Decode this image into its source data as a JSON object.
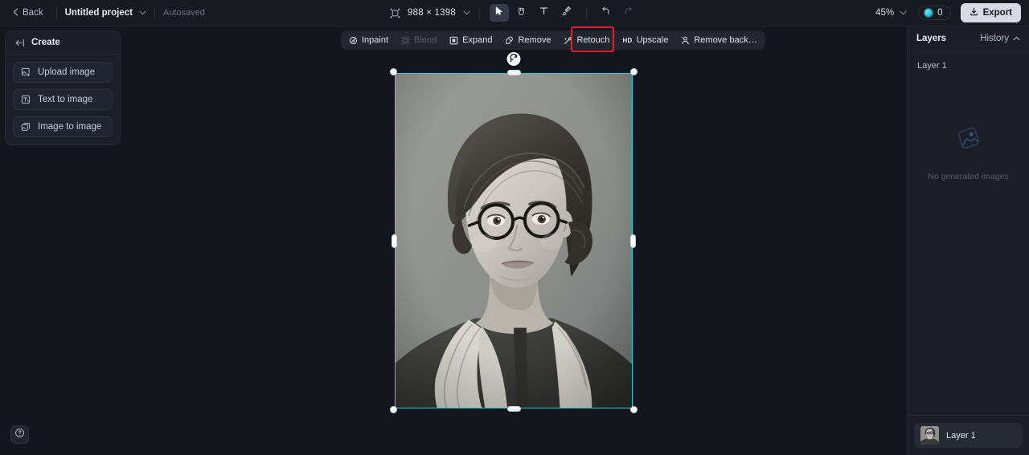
{
  "topbar": {
    "back_label": "Back",
    "project_name": "Untitled project",
    "autosaved_label": "Autosaved",
    "canvas_size": "988 × 1398",
    "zoom_level": "45%",
    "credits_count": "0",
    "export_label": "Export",
    "tools": [
      {
        "name": "select-tool",
        "icon": "cursor-icon",
        "active": true,
        "disabled": false
      },
      {
        "name": "hand-tool",
        "icon": "hand-icon",
        "active": false,
        "disabled": false
      },
      {
        "name": "text-tool",
        "icon": "text-icon",
        "active": false,
        "disabled": false
      },
      {
        "name": "brush-tool",
        "icon": "brush-icon",
        "active": false,
        "disabled": false
      },
      {
        "name": "undo-button",
        "icon": "undo-icon",
        "active": false,
        "disabled": false
      },
      {
        "name": "redo-button",
        "icon": "redo-icon",
        "active": false,
        "disabled": true
      }
    ]
  },
  "sidebar": {
    "title": "Create",
    "items": [
      {
        "label": "Upload image",
        "icon": "upload-image-icon"
      },
      {
        "label": "Text to image",
        "icon": "text-to-image-icon"
      },
      {
        "label": "Image to image",
        "icon": "image-to-image-icon"
      }
    ]
  },
  "floating_toolbar": {
    "items": [
      {
        "label": "Inpaint",
        "icon": "inpaint-icon",
        "disabled": false,
        "highlighted": false
      },
      {
        "label": "Blend",
        "icon": "blend-icon",
        "disabled": true,
        "highlighted": false
      },
      {
        "label": "Expand",
        "icon": "expand-icon",
        "disabled": false,
        "highlighted": false
      },
      {
        "label": "Remove",
        "icon": "remove-icon",
        "disabled": false,
        "highlighted": false
      },
      {
        "label": "Retouch",
        "icon": "retouch-icon",
        "disabled": false,
        "highlighted": false
      },
      {
        "label": "Upscale",
        "icon": "hd-icon",
        "disabled": false,
        "highlighted": true
      },
      {
        "label": "Remove back…",
        "icon": "remove-background-icon",
        "disabled": false,
        "highlighted": false
      }
    ],
    "highlight_color": "#ee1b2e"
  },
  "canvas": {
    "selection_color": "#2ad4d6",
    "image_description": "Vintage black and white portrait of a woman wearing round glasses, wavy hair, dark dress with white lace collar"
  },
  "right_panel": {
    "tab_layers": "Layers",
    "tab_history": "History",
    "layer_group_label": "Layer 1",
    "empty_state_text": "No generated images",
    "layers": [
      {
        "name": "Layer 1"
      }
    ]
  },
  "help": {
    "icon": "help-icon"
  }
}
